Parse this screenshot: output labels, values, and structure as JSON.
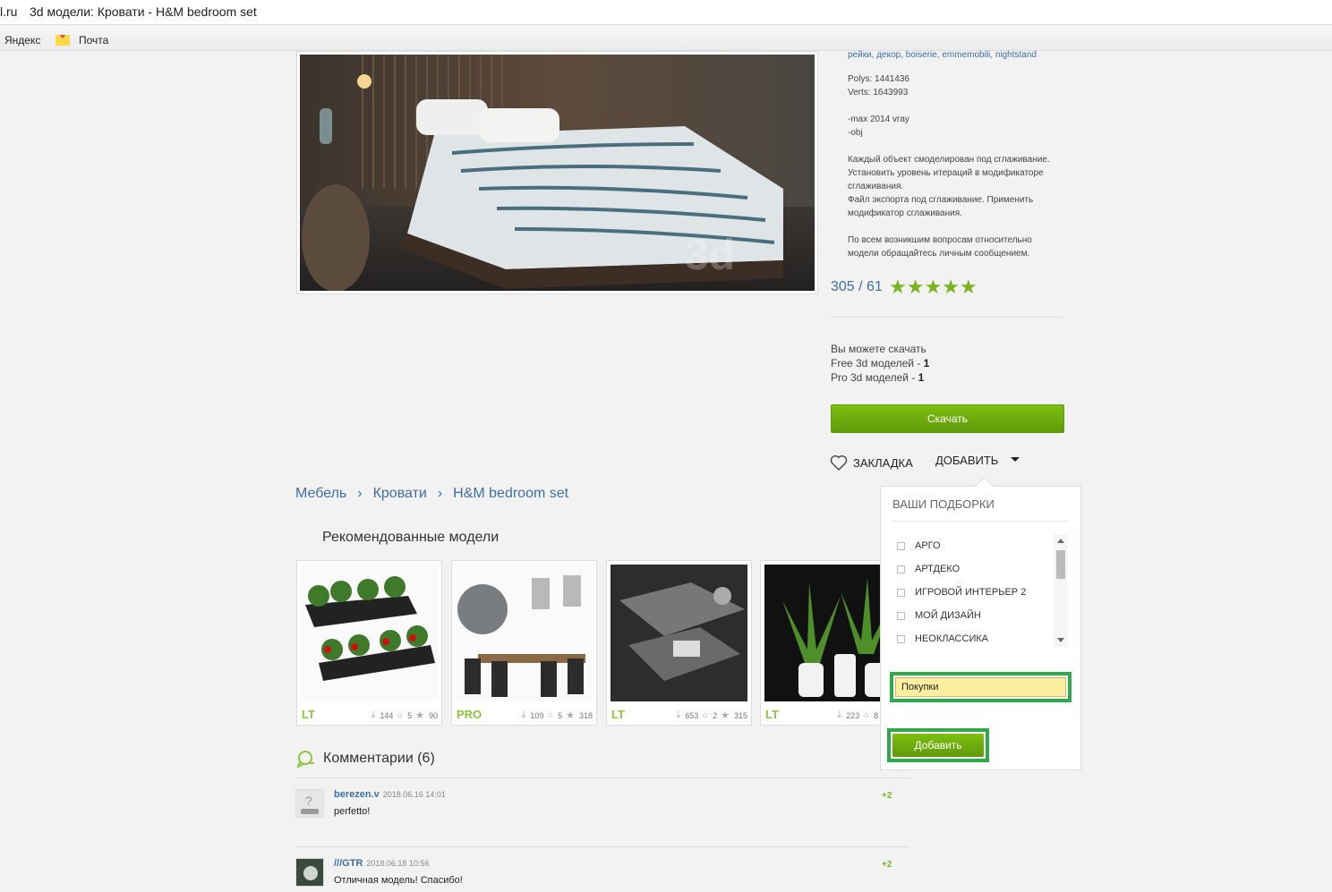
{
  "browser": {
    "domain_fragment": "l.ru",
    "window_title": "3d модели: Кровати - H&M bedroom set",
    "bookmarks": [
      {
        "label": "Яндекс"
      },
      {
        "label": "Почта",
        "icon": "mail-icon"
      }
    ]
  },
  "model": {
    "tags": "рейки, декор, boiserie, emmemobili, nightstand",
    "description": "Polys: 1441436\nVerts: 1643993\n\n-max 2014 vray\n-obj\n\nКаждый объект смоделирован под сглаживание. Установить уровень итераций в модификаторе сглаживания.\nФайл экспорта под сглаживание. Применить модификатор сглаживания.\n\nПо всем возникшим вопросам относительно модели обращайтесь личным сообщением.",
    "rating_text": "305 / 61",
    "stars": 5,
    "download_info": {
      "line1": "Вы можете скачать",
      "free_label": "Free 3d моделей - ",
      "free_count": "1",
      "pro_label": "Pro 3d моделей - ",
      "pro_count": "1"
    },
    "download_button": "Скачать",
    "bookmark_label": "ЗАКЛАДКА",
    "add_label": "ДОБАВИТЬ"
  },
  "breadcrumb": [
    "Мебель",
    "Кровати",
    "H&M bedroom set"
  ],
  "recommended": {
    "title": "Рекомендованные модели",
    "cards": [
      {
        "badge": "LT",
        "downloads": "144",
        "comments": "5",
        "stars": "90"
      },
      {
        "badge": "PRO",
        "downloads": "109",
        "comments": "5",
        "stars": "318"
      },
      {
        "badge": "LT",
        "downloads": "653",
        "comments": "2",
        "stars": "315"
      },
      {
        "badge": "LT",
        "downloads": "223",
        "comments": "8",
        "stars": ""
      }
    ]
  },
  "comments": {
    "title": "Комментарии (6)",
    "items": [
      {
        "user": "berezen.v",
        "date": "2018.06.16 14:01",
        "text": "perfetto!",
        "score": "+2"
      },
      {
        "user": "///GTR",
        "date": "2018.06.18 10:56",
        "text": "Отличная модель! Спасибо!",
        "score": "+2"
      }
    ]
  },
  "collections_popup": {
    "title": "ВАШИ ПОДБОРКИ",
    "items": [
      "АРГО",
      "АРТДЕКО",
      "ИГРОВОЙ ИНТЕРЬЕР 2",
      "МОЙ ДИЗАЙН",
      "НЕОКЛАССИКА"
    ],
    "input_value": "Покупки",
    "submit_label": "Добавить"
  },
  "colors": {
    "accent_green": "#78b41e",
    "link_blue": "#3d6fa5",
    "highlight_border": "#2faa4a"
  }
}
